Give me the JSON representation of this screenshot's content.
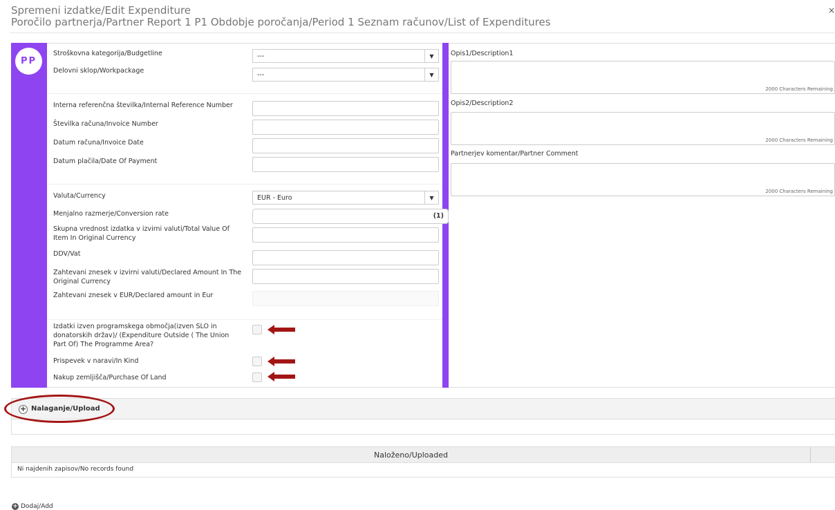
{
  "header": {
    "title": "Spremeni izdatke/Edit Expenditure",
    "breadcrumb": "Poročilo partnerja/Partner Report 1 P1 Obdobje poročanja/Period 1 Seznam računov/List of Expenditures",
    "close": "×"
  },
  "badge": "PP",
  "form": {
    "budgetline_label": "Stroškovna kategorija/Budgetline",
    "budgetline_value": "---",
    "workpackage_label": "Delovni sklop/Workpackage",
    "workpackage_value": "---",
    "internal_ref_label": "Interna referenčna številka/Internal Reference Number",
    "invoice_number_label": "Številka računa/Invoice Number",
    "invoice_date_label": "Datum računa/Invoice Date",
    "payment_date_label": "Datum plačila/Date Of Payment",
    "currency_label": "Valuta/Currency",
    "currency_value": "EUR - Euro",
    "conversion_label": "Menjalno razmerje/Conversion rate",
    "conversion_value": "(1)",
    "total_value_label": "Skupna vrednost izdatka v izvirni valuti/Total Value Of Item In Original Currency",
    "vat_label": "DDV/Vat",
    "declared_orig_label": "Zahtevani znesek v izvirni valuti/Declared Amount In The Original Currency",
    "declared_eur_label": "Zahtevani znesek v EUR/Declared amount in Eur",
    "outside_area_label": "Izdatki izven programskega območja(izven SLO in donatorskih držav)/ (Expenditure Outside ( The Union Part Of) The Programme Area?",
    "in_kind_label": "Prispevek v naravi/In Kind",
    "purchase_land_label": "Nakup zemljišča/Purchase Of Land"
  },
  "right": {
    "desc1_label": "Opis1/Description1",
    "desc2_label": "Opis2/Description2",
    "comment_label": "Partnerjev komentar/Partner Comment",
    "remaining": "2000 Characters Remaining"
  },
  "upload": {
    "label": "Nalaganje/Upload"
  },
  "table": {
    "header": "Naloženo/Uploaded",
    "empty": "Ni najdenih zapisov/No records found"
  },
  "add_label": "Dodaj/Add",
  "colors": {
    "accent": "#8e44f0",
    "annotation": "#a31515"
  }
}
